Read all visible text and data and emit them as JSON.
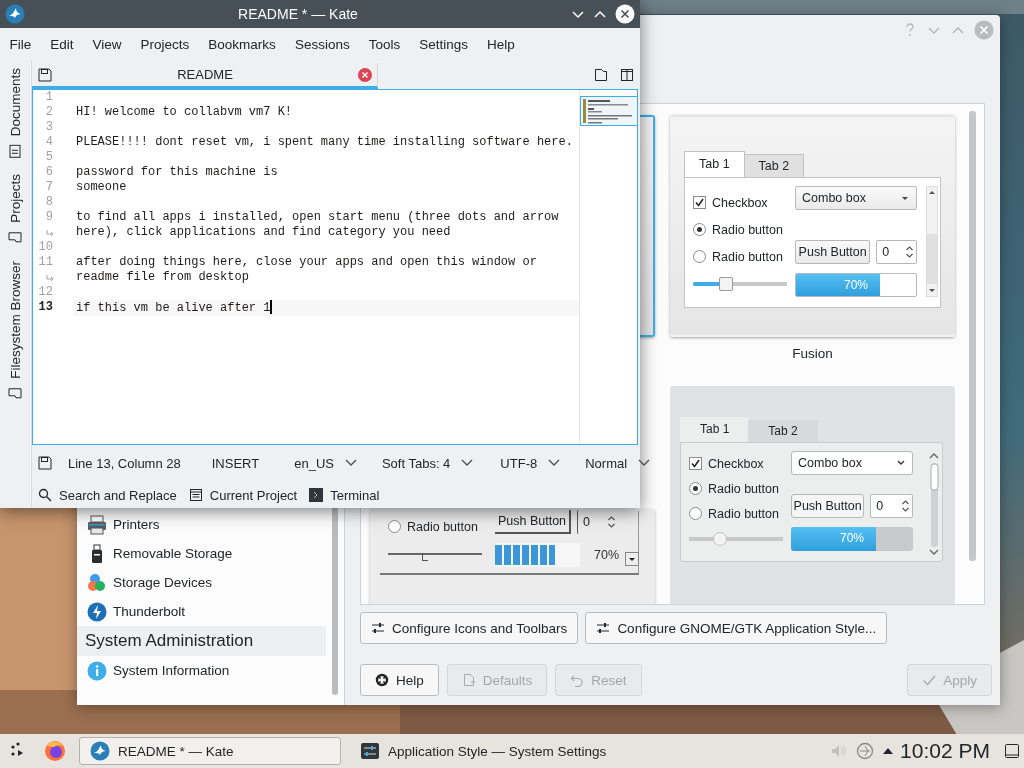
{
  "kate": {
    "title": "README * — Kate",
    "menu": [
      "File",
      "Edit",
      "View",
      "Projects",
      "Bookmarks",
      "Sessions",
      "Tools",
      "Settings",
      "Help"
    ],
    "side_tabs": [
      {
        "label": "Documents",
        "selected": false
      },
      {
        "label": "Projects",
        "selected": false
      },
      {
        "label": "Filesystem Browser",
        "selected": false
      }
    ],
    "document_tabs": [
      {
        "label": "README",
        "selected": true
      }
    ],
    "lines": [
      {
        "number": "1",
        "current": false
      },
      {
        "number": "2",
        "text": "HI! welcome to collabvm vm7 K!",
        "current": false
      },
      {
        "number": "3",
        "current": false
      },
      {
        "number": "4",
        "text": "PLEASE!!!! dont reset vm, i spent many time installing software here.",
        "current": false
      },
      {
        "number": "5",
        "current": false
      },
      {
        "number": "6",
        "text": "password for this machine is",
        "current": false
      },
      {
        "number": "7",
        "text": "someone",
        "current": false
      },
      {
        "number": "8",
        "current": false
      },
      {
        "number": "9",
        "text": "to find all apps i installed, open start menu (three dots and arrow here), click applications and find category you need",
        "current": false
      },
      {
        "number": "10",
        "current": false
      },
      {
        "number": "11",
        "text": "after doing things here, close your apps and open this window or readme file from desktop",
        "current": false
      },
      {
        "number": "12",
        "current": false
      },
      {
        "number": "13",
        "text": "if this vm be alive after 1",
        "current": true
      }
    ],
    "status": {
      "position": "Line 13, Column 28",
      "mode": "INSERT",
      "dropdowns": [
        "en_US",
        "Soft Tabs: 4",
        "UTF-8",
        "Normal"
      ]
    },
    "tool_views": [
      "Search and Replace",
      "Current Project",
      "Terminal"
    ]
  },
  "settings": {
    "sidebar": [
      {
        "kind": "item",
        "label": "Printers"
      },
      {
        "kind": "item",
        "label": "Removable Storage"
      },
      {
        "kind": "item",
        "label": "Storage Devices"
      },
      {
        "kind": "item",
        "label": "Thunderbolt"
      },
      {
        "kind": "header",
        "label": "System Administration"
      },
      {
        "kind": "item",
        "label": "System Information"
      }
    ],
    "previews": [
      {
        "selected": true
      },
      {
        "kind": "fusion",
        "selected": false,
        "label": "Fusion",
        "tabs": [
          {
            "label": "Tab 1",
            "selected": true
          },
          {
            "label": "Tab 2",
            "selected": false
          }
        ],
        "checkbox": {
          "label": "Checkbox",
          "checked": true
        },
        "radios": [
          {
            "label": "Radio button",
            "selected": true
          },
          {
            "label": "Radio button",
            "selected": false
          }
        ],
        "combo": "Combo box",
        "push_button": "Push Button",
        "spin": "0",
        "slider": {
          "level": 0.32
        },
        "progress": {
          "level": 0.7,
          "text": "70%"
        }
      },
      {
        "kind": "oxygen",
        "selected": false,
        "radios": [
          {
            "label": "Radio button",
            "selected": false
          }
        ],
        "push_button": "Push Button",
        "spin": "0",
        "slider": {
          "level": 0.38
        },
        "progress": {
          "level": 0.7,
          "text": "70%"
        }
      },
      {
        "kind": "breeze",
        "selected": false,
        "tabs": [
          {
            "label": "Tab 1",
            "selected": true
          },
          {
            "label": "Tab 2",
            "selected": false
          }
        ],
        "checkbox": {
          "label": "Checkbox",
          "checked": true
        },
        "radios": [
          {
            "label": "Radio button",
            "selected": true
          },
          {
            "label": "Radio button",
            "selected": false
          }
        ],
        "combo": "Combo box",
        "push_button": "Push Button",
        "spin": "0",
        "slider": {
          "level": 0.3
        },
        "progress": {
          "level": 0.7,
          "text": "70%"
        }
      }
    ],
    "config_buttons": [
      "Configure Icons and Toolbars",
      "Configure GNOME/GTK Application Style..."
    ],
    "footer_buttons": [
      {
        "label": "Help",
        "disabled": false
      },
      {
        "label": "Defaults",
        "disabled": true
      },
      {
        "label": "Reset",
        "disabled": true
      },
      {
        "label": "Apply",
        "disabled": true
      }
    ]
  },
  "taskbar": {
    "tasks": [
      {
        "label": "README * — Kate",
        "selected": true
      },
      {
        "label": "Application Style — System Settings",
        "selected": false
      }
    ],
    "clock": "10:02 PM"
  }
}
